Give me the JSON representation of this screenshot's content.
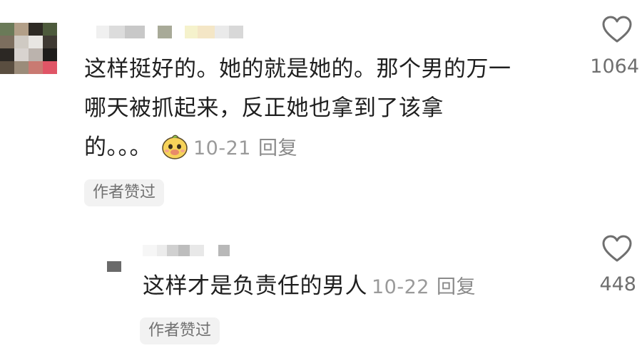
{
  "comment": {
    "lines": [
      "这样挺好的。她的就是她的。那个男的万一",
      "哪天被抓起来，反正她也拿到了该拿",
      "的。。。"
    ],
    "emoji": "smiling-face-sticker",
    "date": "10-21",
    "reply_label": "回复",
    "author_liked_tag": "作者赞过",
    "like_count": "1064",
    "like_icon": "heart-outline-icon"
  },
  "reply": {
    "text": "这样才是负责任的男人",
    "date": "10-22",
    "reply_label": "回复",
    "author_liked_tag": "作者赞过",
    "like_count": "448",
    "like_icon": "heart-outline-icon"
  },
  "colors": {
    "text": "#1f1f1f",
    "meta": "#9a9a9a",
    "tag_bg": "#f2f2f2",
    "heart": "#6f6f6f"
  }
}
